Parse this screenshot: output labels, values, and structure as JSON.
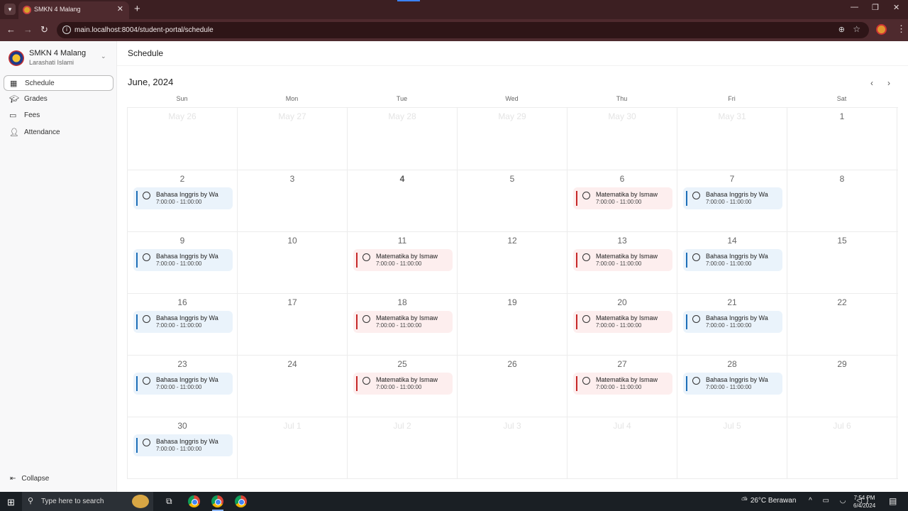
{
  "browser": {
    "tab_title": "SMKN 4 Malang",
    "url": "main.localhost:8004/student-portal/schedule"
  },
  "sidebar": {
    "school": "SMKN 4 Malang",
    "student": "Larashati Islami",
    "items": [
      {
        "label": "Schedule",
        "icon": "calendar-icon"
      },
      {
        "label": "Grades",
        "icon": "graduation-cap-icon"
      },
      {
        "label": "Fees",
        "icon": "money-icon"
      },
      {
        "label": "Attendance",
        "icon": "user-check-icon"
      }
    ],
    "collapse": "Collapse"
  },
  "page": {
    "title": "Schedule",
    "month": "June, 2024"
  },
  "calendar": {
    "days_of_week": [
      "Sun",
      "Mon",
      "Tue",
      "Wed",
      "Thu",
      "Fri",
      "Sat"
    ],
    "weeks": [
      [
        {
          "day": "May 26",
          "other": true
        },
        {
          "day": "May 27",
          "other": true
        },
        {
          "day": "May 28",
          "other": true
        },
        {
          "day": "May 29",
          "other": true
        },
        {
          "day": "May 30",
          "other": true
        },
        {
          "day": "May 31",
          "other": true
        },
        {
          "day": "1"
        }
      ],
      [
        {
          "day": "2",
          "event": {
            "type": "bi",
            "title": "Bahasa Inggris by Wa",
            "time": "7:00:00 - 11:00:00"
          }
        },
        {
          "day": "3"
        },
        {
          "day": "4",
          "today": true
        },
        {
          "day": "5"
        },
        {
          "day": "6",
          "event": {
            "type": "mt",
            "title": "Matematika by Ismaw",
            "time": "7:00:00 - 11:00:00"
          }
        },
        {
          "day": "7",
          "event": {
            "type": "bi",
            "title": "Bahasa Inggris by Wa",
            "time": "7:00:00 - 11:00:00"
          }
        },
        {
          "day": "8"
        }
      ],
      [
        {
          "day": "9",
          "event": {
            "type": "bi",
            "title": "Bahasa Inggris by Wa",
            "time": "7:00:00 - 11:00:00"
          }
        },
        {
          "day": "10"
        },
        {
          "day": "11",
          "event": {
            "type": "mt",
            "title": "Matematika by Ismaw",
            "time": "7:00:00 - 11:00:00"
          }
        },
        {
          "day": "12"
        },
        {
          "day": "13",
          "event": {
            "type": "mt",
            "title": "Matematika by Ismaw",
            "time": "7:00:00 - 11:00:00"
          }
        },
        {
          "day": "14",
          "event": {
            "type": "bi",
            "title": "Bahasa Inggris by Wa",
            "time": "7:00:00 - 11:00:00"
          }
        },
        {
          "day": "15"
        }
      ],
      [
        {
          "day": "16",
          "event": {
            "type": "bi",
            "title": "Bahasa Inggris by Wa",
            "time": "7:00:00 - 11:00:00"
          }
        },
        {
          "day": "17"
        },
        {
          "day": "18",
          "event": {
            "type": "mt",
            "title": "Matematika by Ismaw",
            "time": "7:00:00 - 11:00:00"
          }
        },
        {
          "day": "19"
        },
        {
          "day": "20",
          "event": {
            "type": "mt",
            "title": "Matematika by Ismaw",
            "time": "7:00:00 - 11:00:00"
          }
        },
        {
          "day": "21",
          "event": {
            "type": "bi",
            "title": "Bahasa Inggris by Wa",
            "time": "7:00:00 - 11:00:00"
          }
        },
        {
          "day": "22"
        }
      ],
      [
        {
          "day": "23",
          "event": {
            "type": "bi",
            "title": "Bahasa Inggris by Wa",
            "time": "7:00:00 - 11:00:00"
          }
        },
        {
          "day": "24"
        },
        {
          "day": "25",
          "event": {
            "type": "mt",
            "title": "Matematika by Ismaw",
            "time": "7:00:00 - 11:00:00"
          }
        },
        {
          "day": "26"
        },
        {
          "day": "27",
          "event": {
            "type": "mt",
            "title": "Matematika by Ismaw",
            "time": "7:00:00 - 11:00:00"
          }
        },
        {
          "day": "28",
          "event": {
            "type": "bi",
            "title": "Bahasa Inggris by Wa",
            "time": "7:00:00 - 11:00:00"
          }
        },
        {
          "day": "29"
        }
      ],
      [
        {
          "day": "30",
          "event": {
            "type": "bi",
            "title": "Bahasa Inggris by Wa",
            "time": "7:00:00 - 11:00:00"
          }
        },
        {
          "day": "Jul 1",
          "other": true
        },
        {
          "day": "Jul 2",
          "other": true
        },
        {
          "day": "Jul 3",
          "other": true
        },
        {
          "day": "Jul 4",
          "other": true
        },
        {
          "day": "Jul 5",
          "other": true
        },
        {
          "day": "Jul 6",
          "other": true
        }
      ]
    ]
  },
  "taskbar": {
    "search_placeholder": "Type here to search",
    "weather": "26°C  Berawan",
    "time": "7:54 PM",
    "date": "6/4/2024"
  },
  "colors": {
    "accent_blue": "#1e6fb8",
    "accent_red": "#c62828",
    "event_blue_bg": "#eaf3fb",
    "event_red_bg": "#fdeeee",
    "browser_frame": "#3c1f22"
  }
}
